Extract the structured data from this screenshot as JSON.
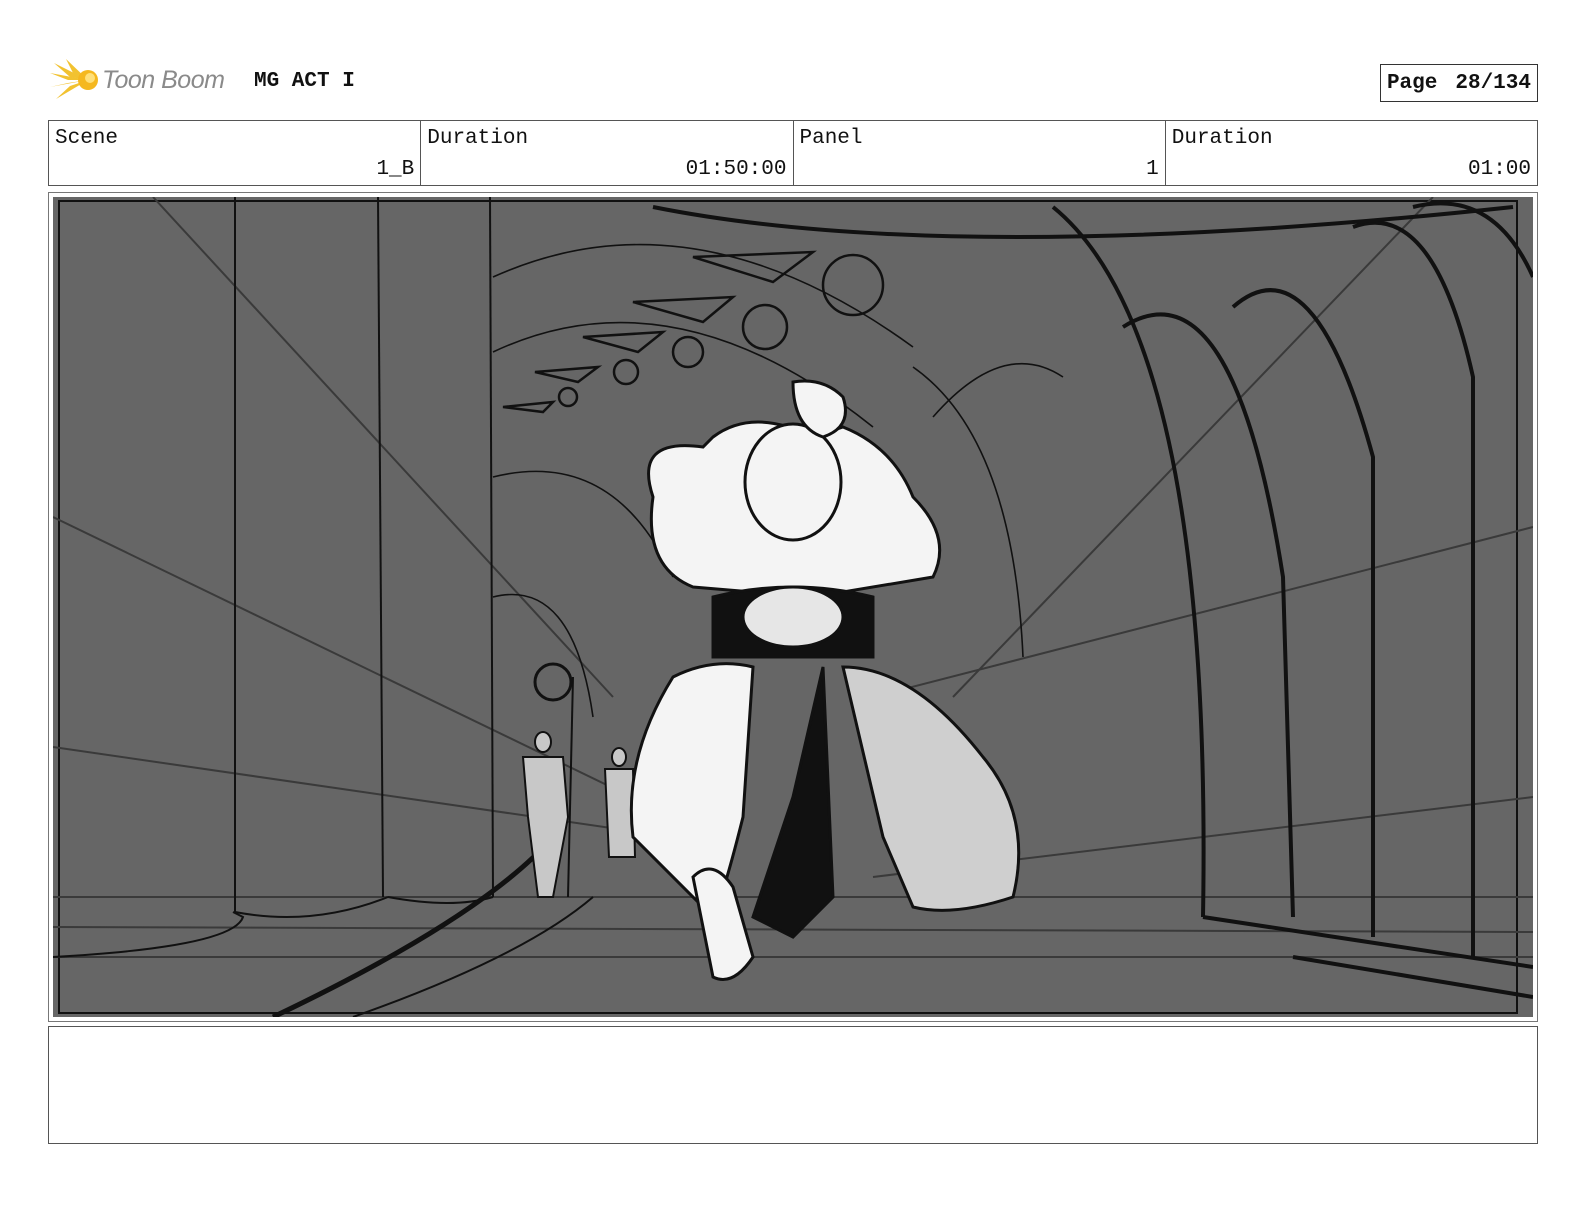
{
  "header": {
    "logo_text": "Toon Boom",
    "project_title": "MG ACT I",
    "page_label": "Page",
    "page_value": "28/134"
  },
  "info": {
    "scene_label": "Scene",
    "scene_value": "1_B",
    "scene_duration_label": "Duration",
    "scene_duration_value": "01:50:00",
    "panel_label": "Panel",
    "panel_value": "1",
    "panel_duration_label": "Duration",
    "panel_duration_value": "01:00"
  },
  "panel": {
    "icon": "storyboard-sketch-image",
    "background_color": "#666666"
  },
  "notes": {
    "text": ""
  }
}
